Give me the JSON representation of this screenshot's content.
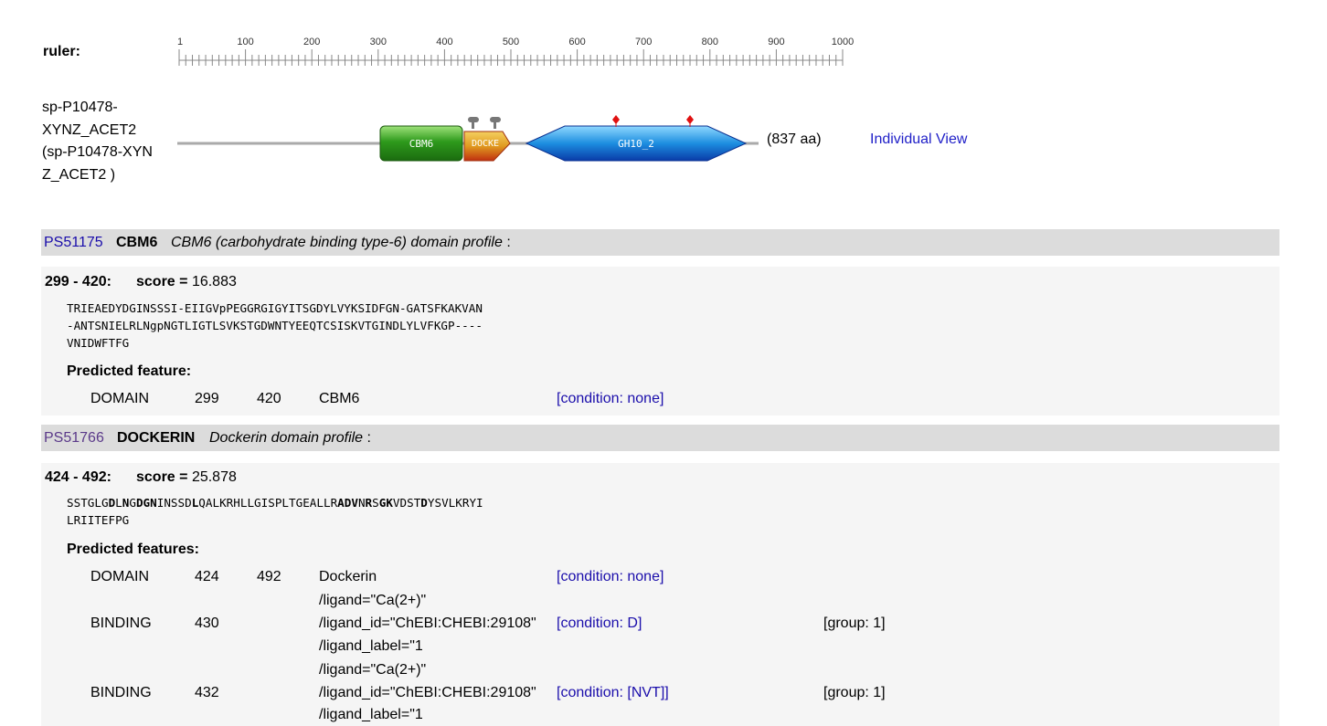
{
  "ruler": {
    "label": "ruler:",
    "ticks": [
      "1",
      "100",
      "200",
      "300",
      "400",
      "500",
      "600",
      "700",
      "800",
      "900",
      "1000"
    ]
  },
  "protein": {
    "name_lines": [
      "sp-P10478-",
      "XYNZ_ACET2",
      "(sp-P10478-XYN",
      "Z_ACET2 )"
    ],
    "length_label": "(837 aa)",
    "individual_view": "Individual View",
    "domains": [
      {
        "label": "CBM6",
        "color": "#2e8b1e"
      },
      {
        "label": "DOCKE",
        "color": "#e0a020"
      },
      {
        "label": "GH10_2",
        "color": "#1e90d8"
      }
    ]
  },
  "hits": [
    {
      "accession": "PS51175",
      "name": "CBM6",
      "description": "CBM6 (carbohydrate binding type-6) domain profile",
      "sep": ":",
      "range": "299 - 420:",
      "score_label": "score =",
      "score": "16.883",
      "sequence": [
        "TRIEAEDYDGINSSSI-EIIGVpPEGGRGIGYITSGDYLVYKSIDFGN-GATSFKAKVAN",
        "-ANTSNIELRLNgpNGTLIGTLSVKSTGDWNTYEEQTCSISKVTGINDLYLVFKGP----",
        "VNIDWFTFG"
      ],
      "features_label": "Predicted feature:",
      "features": [
        {
          "type": "DOMAIN",
          "start": "299",
          "end": "420",
          "desc": "CBM6",
          "cond": "[condition: none]"
        }
      ]
    },
    {
      "accession": "PS51766",
      "name": "DOCKERIN",
      "description": "Dockerin domain profile",
      "sep": ":",
      "range": "424 - 492:",
      "score_label": "score =",
      "score": "25.878",
      "sequence": [
        "SSTGLGDLNGDGNINSSDLQALKRHLLGISPLTGEALLRADVNRSGKVDSTDYSVLKRYI",
        "LRIITEFPG"
      ],
      "features_label": "Predicted features:",
      "features": [
        {
          "type": "DOMAIN",
          "start": "424",
          "end": "492",
          "desc": "Dockerin",
          "cond": "[condition: none]"
        },
        {
          "type": "BINDING",
          "start": "430",
          "desc_lines": [
            "/ligand=\"Ca(2+)\"",
            "/ligand_id=\"ChEBI:CHEBI:29108\"",
            "/ligand_label=\"1"
          ],
          "cond": "[condition: D]",
          "group": "[group: 1]"
        },
        {
          "type": "BINDING",
          "start": "432",
          "desc_lines": [
            "/ligand=\"Ca(2+)\"",
            "/ligand_id=\"ChEBI:CHEBI:29108\"",
            "/ligand_label=\"1"
          ],
          "cond": "[condition: [NVT]]",
          "group": "[group: 1]"
        }
      ]
    }
  ]
}
